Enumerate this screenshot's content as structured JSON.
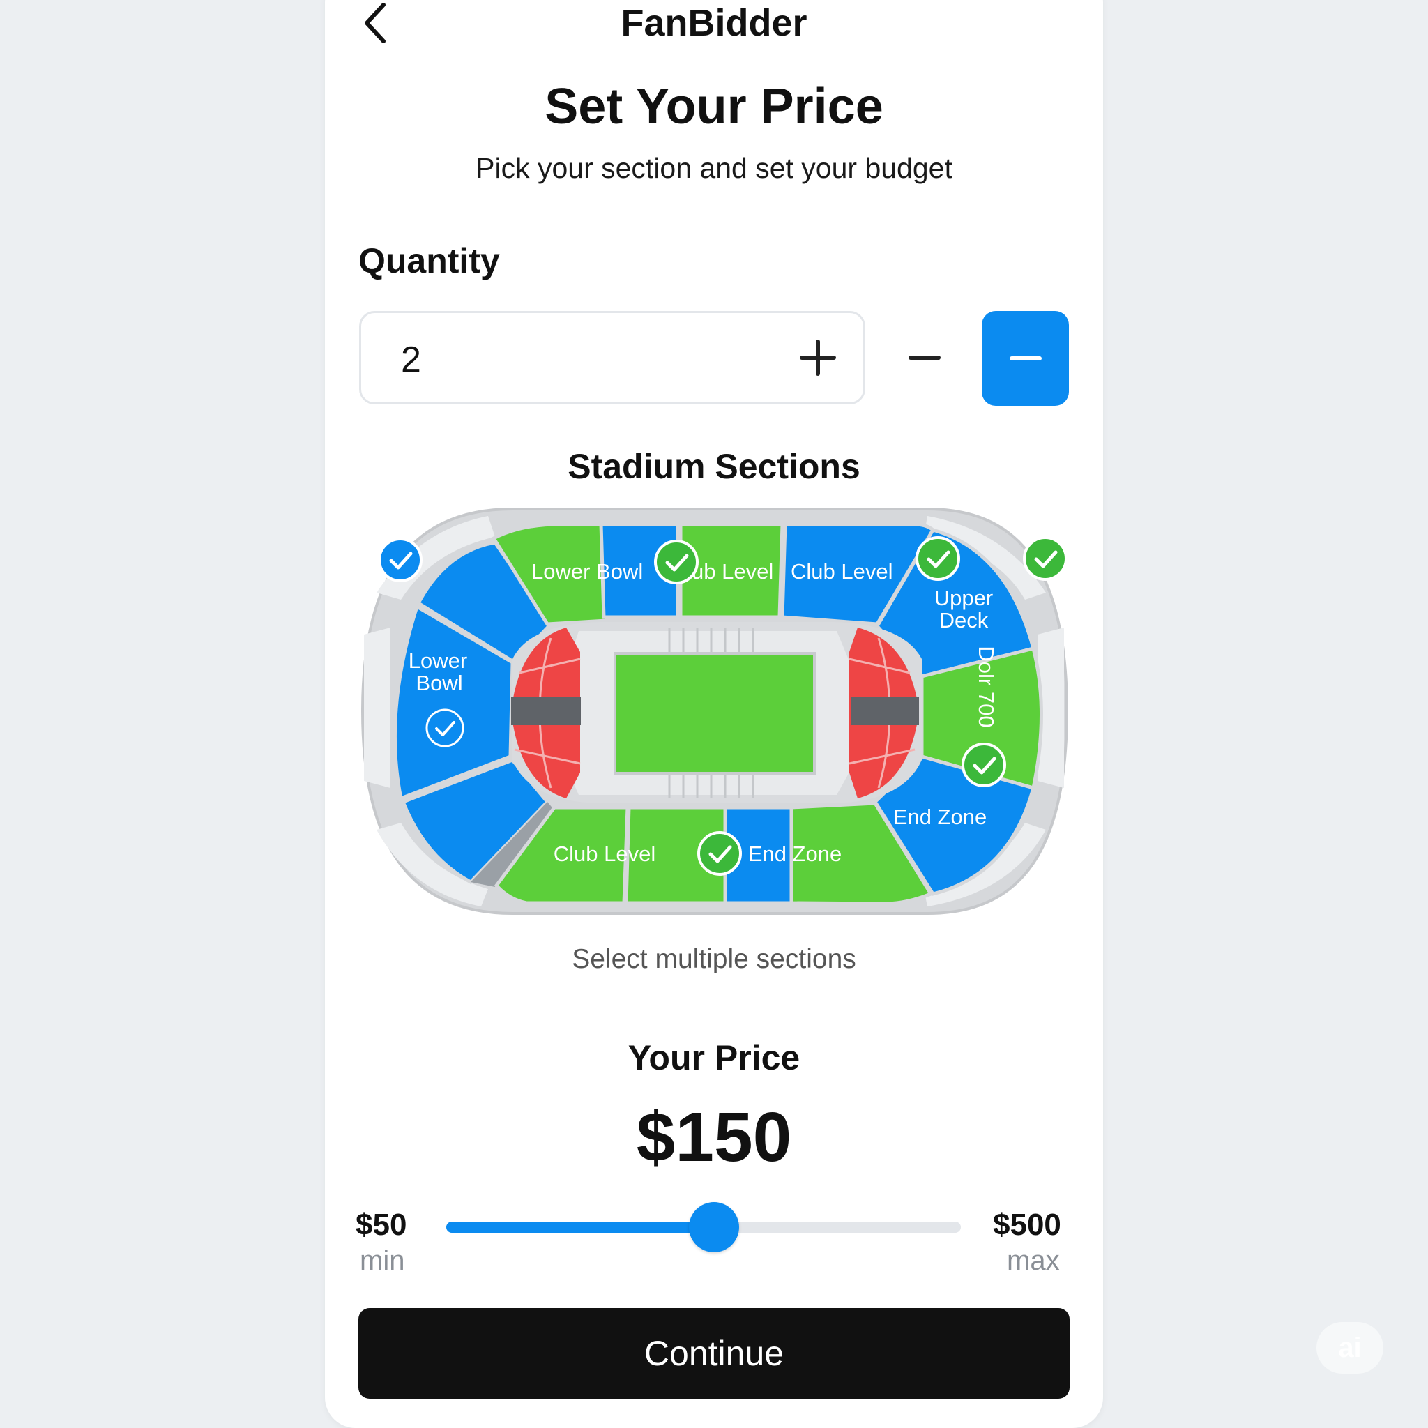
{
  "header": {
    "app_title": "FanBidder",
    "back_icon": "chevron-left-icon"
  },
  "page": {
    "title": "Set Your Price",
    "subtitle": "Pick your section and set your budget"
  },
  "quantity": {
    "label": "Quantity",
    "value": "2",
    "increment_icon": "plus-icon",
    "decrement_icon": "minus-icon"
  },
  "stadium": {
    "title": "Stadium Sections",
    "hint": "Select multiple sections",
    "section_labels": {
      "top_lower_bowl": "Lower Bowl",
      "top_club_partial": "ub Level",
      "top_club_level": "Club Level",
      "upper_deck_line1": "Upper",
      "upper_deck_line2": "Deck",
      "left_lower_bowl_line1": "Lower",
      "left_lower_bowl_line2": "Bowl",
      "right_vertical": "Dolr 700",
      "right_end_zone": "End Zone",
      "bottom_club_level": "Club Level",
      "bottom_end_zone": "End Zone"
    },
    "colors": {
      "blue": "#0b8bf0",
      "green": "#5ccf3a",
      "red": "#ee4545",
      "gray": "#d3d5d8"
    }
  },
  "price": {
    "label": "Your Price",
    "value": "$150",
    "min_value": "$50",
    "min_caption": "min",
    "max_value": "$500",
    "max_caption": "max",
    "slider_fraction": 0.52
  },
  "actions": {
    "continue_label": "Continue"
  },
  "watermark": "ai"
}
